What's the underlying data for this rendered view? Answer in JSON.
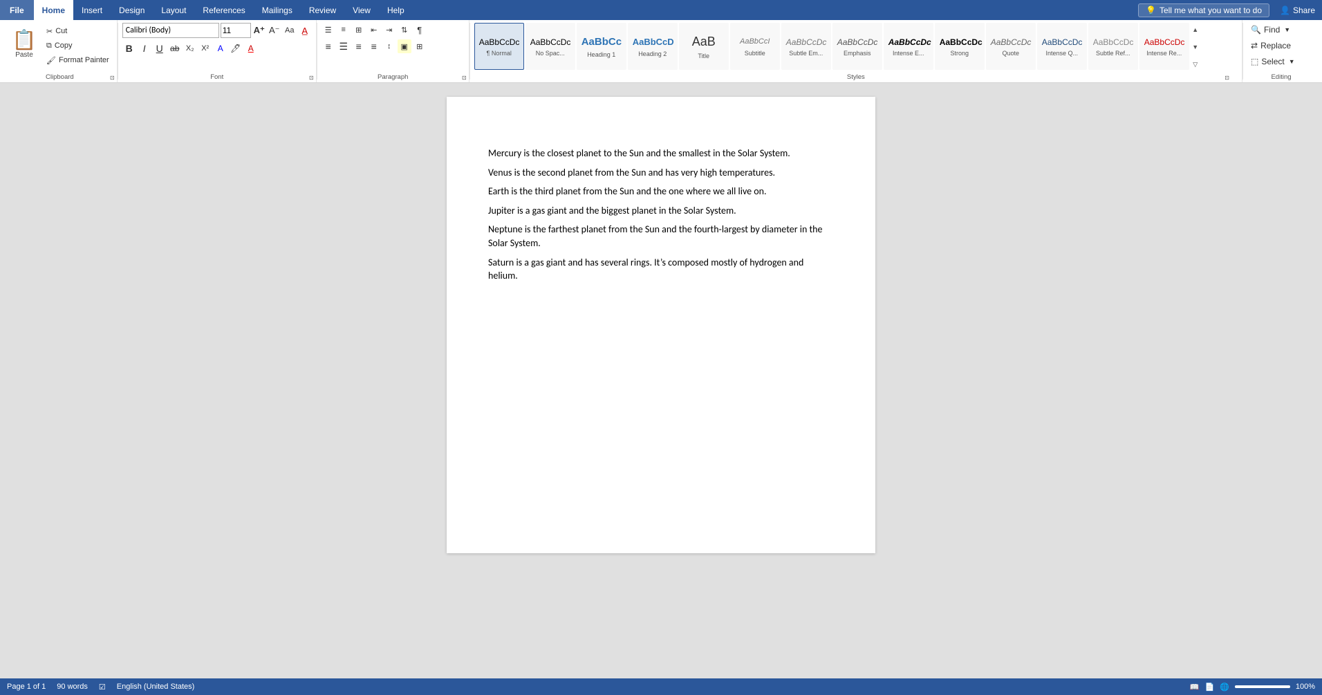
{
  "tabs": {
    "items": [
      {
        "label": "File",
        "id": "file",
        "active": false
      },
      {
        "label": "Home",
        "id": "home",
        "active": true
      },
      {
        "label": "Insert",
        "id": "insert",
        "active": false
      },
      {
        "label": "Design",
        "id": "design",
        "active": false
      },
      {
        "label": "Layout",
        "id": "layout",
        "active": false
      },
      {
        "label": "References",
        "id": "references",
        "active": false
      },
      {
        "label": "Mailings",
        "id": "mailings",
        "active": false
      },
      {
        "label": "Review",
        "id": "review",
        "active": false
      },
      {
        "label": "View",
        "id": "view",
        "active": false
      },
      {
        "label": "Help",
        "id": "help",
        "active": false
      }
    ]
  },
  "tell_me": {
    "placeholder": "Tell me what you want to do"
  },
  "share": {
    "label": "Share"
  },
  "clipboard": {
    "label": "Clipboard",
    "paste_label": "Paste",
    "cut_label": "Cut",
    "copy_label": "Copy",
    "format_painter_label": "Format Painter"
  },
  "font": {
    "label": "Font",
    "name": "Calibri (Body)",
    "size": "11",
    "bold": "B",
    "italic": "I",
    "underline": "U"
  },
  "paragraph": {
    "label": "Paragraph"
  },
  "styles": {
    "label": "Styles",
    "items": [
      {
        "id": "normal",
        "preview": "AaBbCcDc",
        "name": "¶ Normal",
        "class": "normal-style",
        "selected": true
      },
      {
        "id": "no-spacing",
        "preview": "AaBbCcDc",
        "name": "No Spac...",
        "class": "nospace-style"
      },
      {
        "id": "heading1",
        "preview": "AaBbCc",
        "name": "Heading 1",
        "class": "h1-style"
      },
      {
        "id": "heading2",
        "preview": "AaBbCcD",
        "name": "Heading 2",
        "class": "h2-style"
      },
      {
        "id": "title",
        "preview": "AaB",
        "name": "Title",
        "class": "title-style"
      },
      {
        "id": "subtitle",
        "preview": "AaBbCcI",
        "name": "Subtitle",
        "class": "subtitle-style"
      },
      {
        "id": "subtle-em",
        "preview": "AaBbCcDc",
        "name": "Subtle Em...",
        "class": "subtleem-style"
      },
      {
        "id": "emphasis",
        "preview": "AaBbCcDc",
        "name": "Emphasis",
        "class": "emphasis-style"
      },
      {
        "id": "intense-em",
        "preview": "AaBbCcDc",
        "name": "Intense E...",
        "class": "intenseem-style"
      },
      {
        "id": "strong",
        "preview": "AaBbCcDc",
        "name": "Strong",
        "class": "strong-style"
      },
      {
        "id": "quote",
        "preview": "AaBbCcDc",
        "name": "Quote",
        "class": "quote-style"
      },
      {
        "id": "intense-q",
        "preview": "AaBbCcDc",
        "name": "Intense Q...",
        "class": "normal-style"
      },
      {
        "id": "subtle-ref",
        "preview": "AaBbCcDc",
        "name": "Subtle Ref...",
        "class": "normal-style"
      },
      {
        "id": "intense-re",
        "preview": "AaBbCcDc",
        "name": "Intense Re...",
        "class": "normal-style"
      }
    ]
  },
  "editing": {
    "label": "Editing",
    "find_label": "Find",
    "replace_label": "Replace",
    "select_label": "Select"
  },
  "document": {
    "paragraphs": [
      "Mercury is the closest planet to the Sun and the smallest in the Solar System.",
      "Venus is the second planet from the Sun and has very high temperatures.",
      "Earth is the third planet from the Sun and the one where we all live on.",
      "Jupiter is a gas giant and the biggest planet in the Solar System.",
      "Neptune is the farthest planet from the Sun and the fourth-largest by diameter in the Solar System.",
      "Saturn is a gas giant and has several rings. It’s composed mostly of hydrogen and helium."
    ]
  },
  "status": {
    "page": "Page 1 of 1",
    "words": "90 words",
    "language": "English (United States)",
    "zoom": "100%"
  }
}
